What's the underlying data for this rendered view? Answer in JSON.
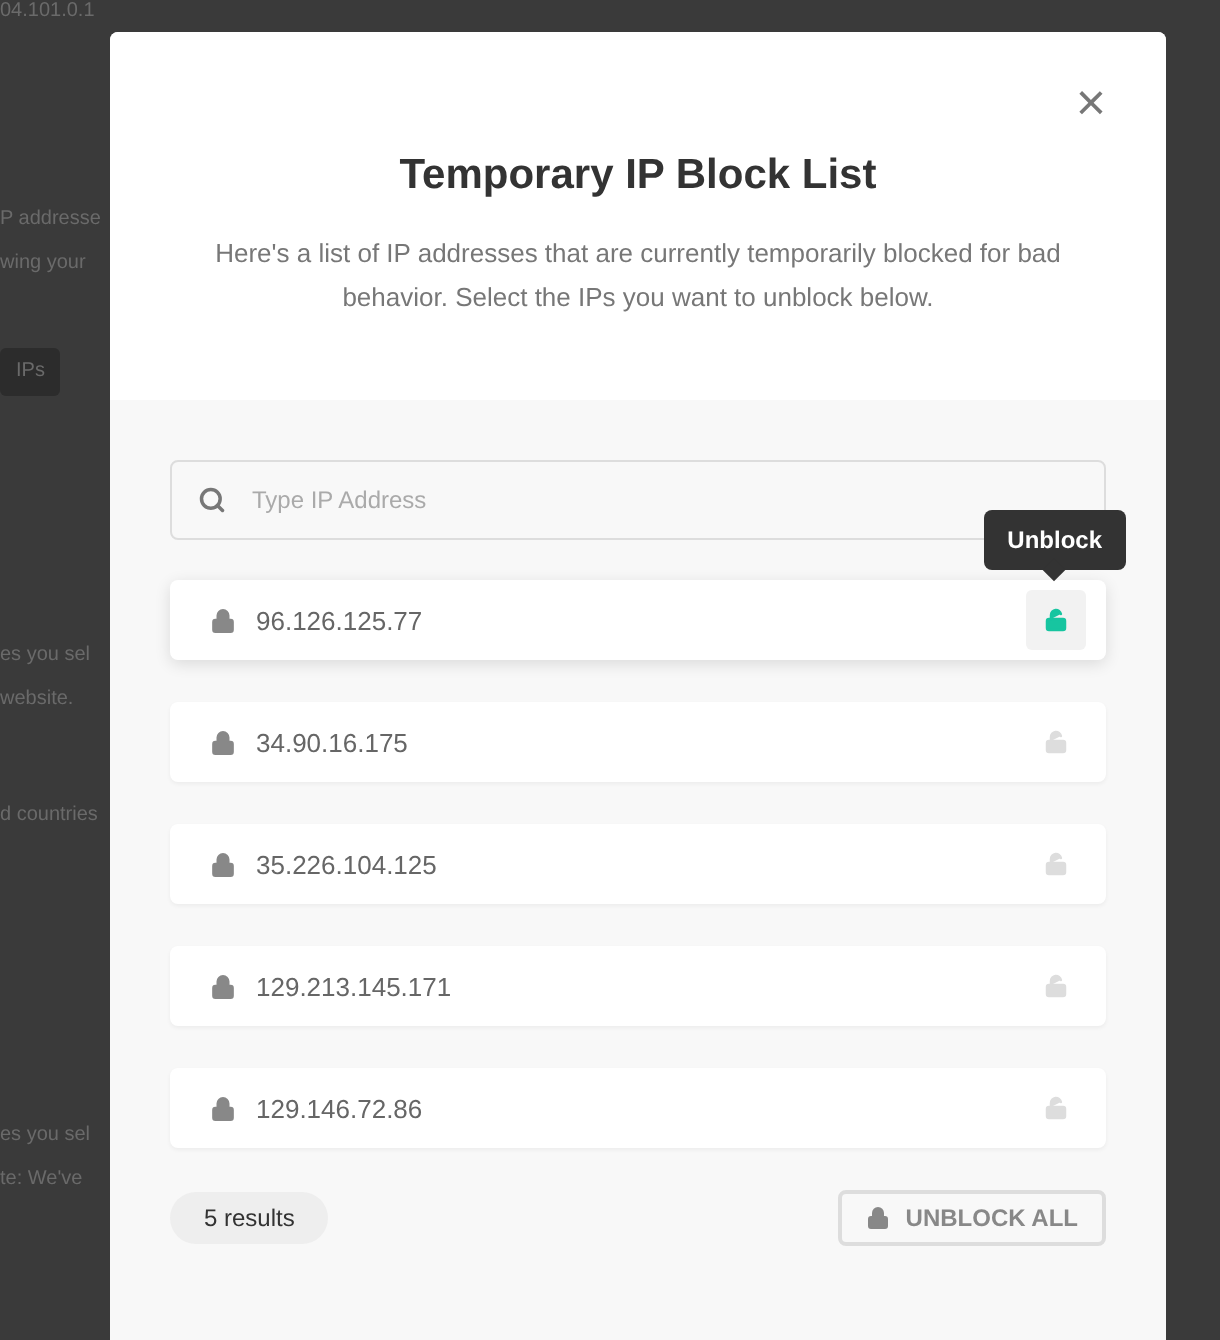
{
  "background_page": {
    "lines": [
      "04.101.0.1",
      "P addresse",
      "wing your",
      "IPs",
      "es you sel",
      "website.",
      "d countries",
      "es you sel",
      "te: We've"
    ]
  },
  "modal": {
    "close": "×",
    "title": "Temporary IP Block List",
    "description": "Here's a list of IP addresses that are currently temporarily blocked for bad behavior. Select the IPs you want to unblock below.",
    "search": {
      "placeholder": "Type IP Address"
    },
    "rows": [
      {
        "ip": "96.126.125.77",
        "hovered": true,
        "tooltip": "Unblock"
      },
      {
        "ip": "34.90.16.175",
        "hovered": false
      },
      {
        "ip": "35.226.104.125",
        "hovered": false
      },
      {
        "ip": "129.213.145.171",
        "hovered": false
      },
      {
        "ip": "129.146.72.86",
        "hovered": false
      }
    ],
    "results": "5 results",
    "unblock_all": "UNBLOCK ALL"
  }
}
